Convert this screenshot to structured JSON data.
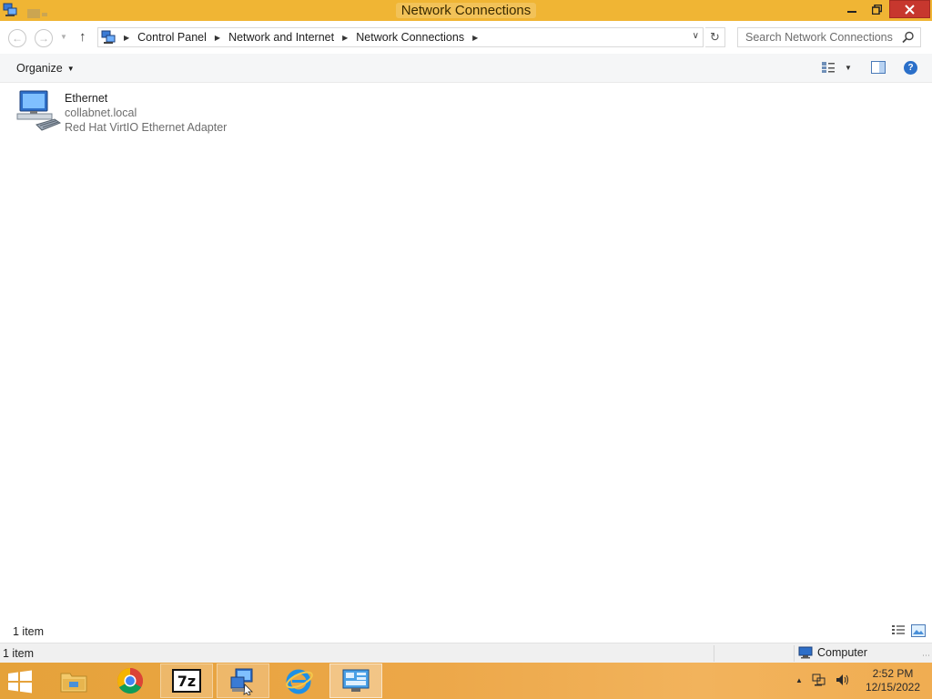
{
  "window": {
    "title": "Network Connections",
    "icons": {
      "app": "network-connections-icon",
      "minimize": "minimize-icon",
      "maximize": "restore-icon",
      "close": "close-icon"
    }
  },
  "navigation": {
    "breadcrumbs": [
      "Control Panel",
      "Network and Internet",
      "Network Connections"
    ],
    "search_placeholder": "Search Network Connections"
  },
  "commandbar": {
    "organize_label": "Organize"
  },
  "items": [
    {
      "name": "Ethernet",
      "domain": "collabnet.local",
      "adapter": "Red Hat VirtIO Ethernet Adapter",
      "icon": "network-adapter-icon"
    }
  ],
  "status": {
    "inner_count": "1 item",
    "count": "1 item",
    "zone": "Computer"
  },
  "taskbar": {
    "apps": [
      "file-explorer",
      "chrome",
      "7-zip",
      "network-tool",
      "internet-explorer",
      "control-panel"
    ],
    "time": "2:52 PM",
    "date": "12/15/2022"
  },
  "colors": {
    "accent": "#f0b534",
    "close": "#c7372e",
    "taskbar": "#eca748"
  }
}
